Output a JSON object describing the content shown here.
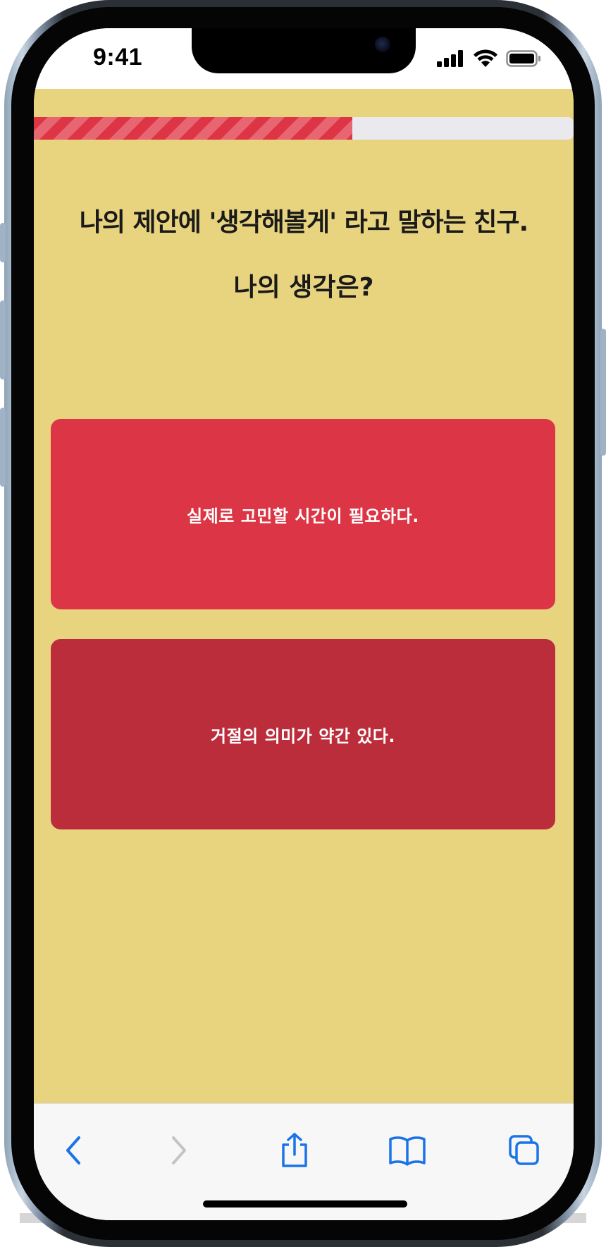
{
  "status_bar": {
    "time": "9:41"
  },
  "quiz": {
    "progress_fraction": 0.59,
    "question_line1": "나의 제안에 '생각해볼게' 라고 말하는 친구.",
    "question_line2": "나의 생각은?",
    "answers": [
      {
        "label": "실제로 고민할 시간이 필요하다."
      },
      {
        "label": "거절의 의미가 약간 있다."
      }
    ]
  },
  "colors": {
    "background": "#e8d47f",
    "answer_primary": "#dc3545",
    "answer_secondary": "#bb2d3b",
    "progress_fill": "#dd3545",
    "progress_track": "#e9e9ee",
    "toolbar_accent": "#1a73e8"
  },
  "toolbar": {
    "icons": [
      "back-icon",
      "forward-icon",
      "share-icon",
      "bookmarks-icon",
      "tabs-icon"
    ]
  }
}
